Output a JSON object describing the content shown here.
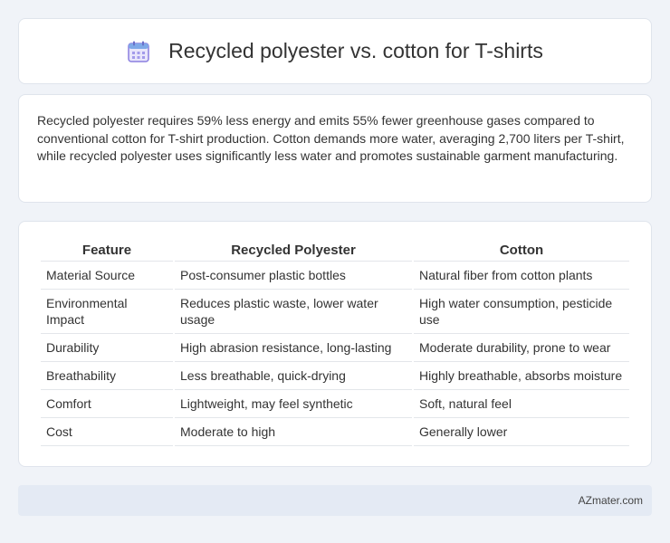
{
  "header": {
    "icon": "calendar-icon",
    "title": "Recycled polyester vs. cotton for T-shirts"
  },
  "summary": {
    "text": "Recycled polyester requires 59% less energy and emits 55% fewer greenhouse gases compared to conventional cotton for T-shirt production. Cotton demands more water, averaging 2,700 liters per T-shirt, while recycled polyester uses significantly less water and promotes sustainable garment manufacturing."
  },
  "table": {
    "headers": [
      "Feature",
      "Recycled Polyester",
      "Cotton"
    ],
    "rows": [
      [
        "Material Source",
        "Post-consumer plastic bottles",
        "Natural fiber from cotton plants"
      ],
      [
        "Environmental Impact",
        "Reduces plastic waste, lower water usage",
        "High water consumption, pesticide use"
      ],
      [
        "Durability",
        "High abrasion resistance, long-lasting",
        "Moderate durability, prone to wear"
      ],
      [
        "Breathability",
        "Less breathable, quick-drying",
        "Highly breathable, absorbs moisture"
      ],
      [
        "Comfort",
        "Lightweight, may feel synthetic",
        "Soft, natural feel"
      ],
      [
        "Cost",
        "Moderate to high",
        "Generally lower"
      ]
    ]
  },
  "footer": {
    "brand": "AZmater.com"
  },
  "colors": {
    "background": "#f0f3f8",
    "footer_bg": "#e4eaf4",
    "icon_accent": "#8a7fe0"
  }
}
